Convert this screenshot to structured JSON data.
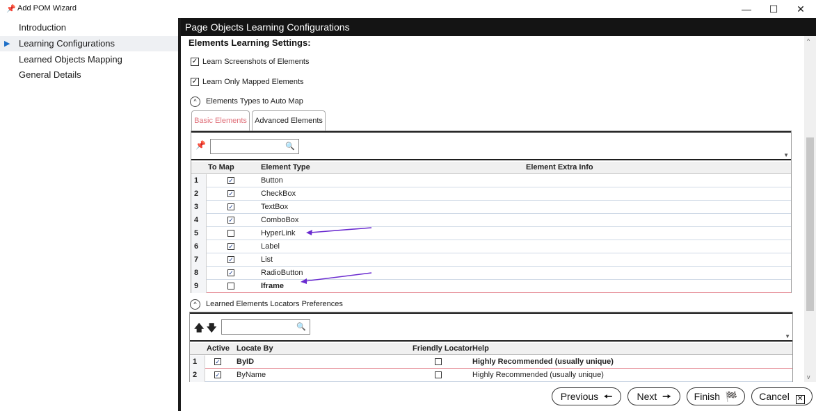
{
  "window": {
    "title": "Add POM Wizard",
    "controls": [
      "—",
      "☐",
      "✕"
    ]
  },
  "sidebar": {
    "items": [
      {
        "label": "Introduction"
      },
      {
        "label": "Learning Configurations",
        "active": true
      },
      {
        "label": "Learned Objects Mapping"
      },
      {
        "label": "General Details"
      }
    ]
  },
  "main": {
    "header": "Page Objects Learning Configurations",
    "section_title": "Elements Learning Settings:",
    "options": [
      {
        "label": "Learn Screenshots of Elements",
        "checked": true
      },
      {
        "label": "Learn Only Mapped Elements",
        "checked": true
      }
    ],
    "types_expander": "Elements Types to Auto Map",
    "tabs": [
      {
        "label": "Basic Elements",
        "selected": true
      },
      {
        "label": "Advanced Elements"
      }
    ],
    "types_grid": {
      "search_value": "",
      "columns": [
        "To Map",
        "Element Type",
        "Element Extra Info"
      ],
      "rows": [
        {
          "num": "1",
          "checked": true,
          "type": "Button"
        },
        {
          "num": "2",
          "checked": true,
          "type": "CheckBox"
        },
        {
          "num": "3",
          "checked": true,
          "type": "TextBox"
        },
        {
          "num": "4",
          "checked": true,
          "type": "ComboBox"
        },
        {
          "num": "5",
          "checked": false,
          "type": "HyperLink"
        },
        {
          "num": "6",
          "checked": true,
          "type": "Label"
        },
        {
          "num": "7",
          "checked": true,
          "type": "List"
        },
        {
          "num": "8",
          "checked": true,
          "type": "RadioButton"
        },
        {
          "num": "9",
          "checked": false,
          "type": "Iframe",
          "selected": true
        }
      ]
    },
    "locators_expander": "Learned Elements Locators Preferences",
    "locators_grid": {
      "search_value": "",
      "columns": [
        "Active",
        "Locate By",
        "Friendly Locator",
        "Help"
      ],
      "rows": [
        {
          "num": "1",
          "active": true,
          "locate_by": "ByID",
          "friendly": false,
          "help": "Highly Recommended (usually unique)",
          "selected": true
        },
        {
          "num": "2",
          "active": true,
          "locate_by": "ByName",
          "friendly": false,
          "help": "Highly Recommended (usually unique)"
        }
      ]
    }
  },
  "footer": {
    "previous": "Previous",
    "next": "Next",
    "finish": "Finish",
    "cancel": "Cancel"
  },
  "colors": {
    "header_bg": "#141414",
    "selected_tab": "#e0707a",
    "annotation_arrow": "#6a2bd0",
    "sidebar_arrow": "#1e6fc7"
  },
  "icons": {
    "app": "pin-icon",
    "previous": "arrow-left-icon",
    "next": "arrow-right-icon",
    "finish": "checkered-flag-icon",
    "cancel": "close-box-icon"
  }
}
